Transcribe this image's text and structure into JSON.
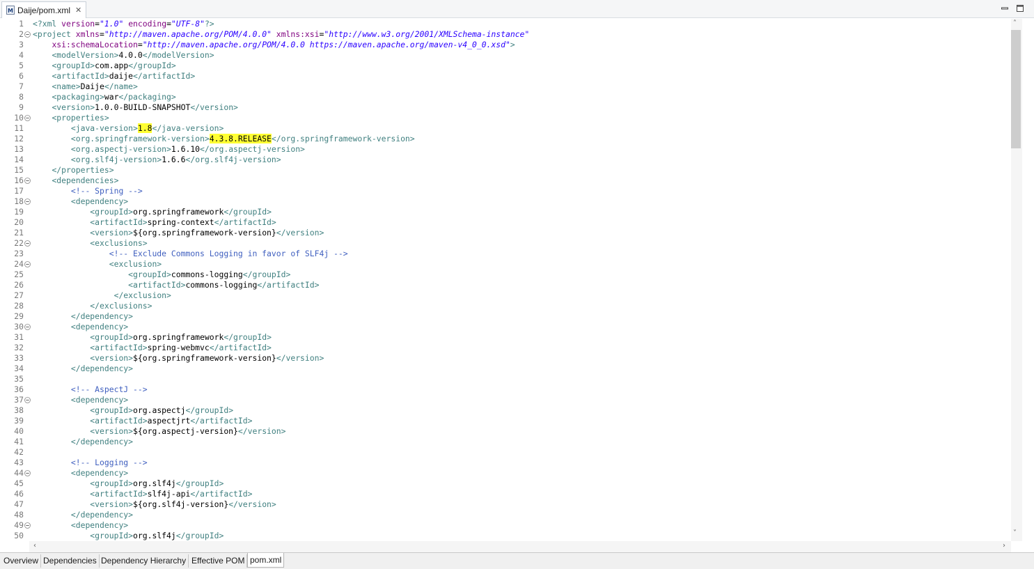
{
  "editor_tab": {
    "title": "Daije/pom.xml",
    "close": "✕",
    "icon": "maven-file-icon"
  },
  "window_controls": {
    "minimize": "minimize-icon",
    "maximize": "maximize-icon"
  },
  "colors": {
    "tag": "#3f7f7f",
    "attr": "#7f007f",
    "value": "#2a00ff",
    "comment": "#3f5fbf",
    "highlight": "#ffff33",
    "text": "#000000",
    "line_number": "#787878"
  },
  "code_lines": [
    {
      "n": "1",
      "fold": false,
      "indent": 0,
      "segs": [
        [
          "t",
          "<?xml "
        ],
        [
          "a",
          "version"
        ],
        [
          "x",
          "="
        ],
        [
          "s",
          "\"1.0\""
        ],
        [
          "x",
          " "
        ],
        [
          "a",
          "encoding"
        ],
        [
          "x",
          "="
        ],
        [
          "s",
          "\"UTF-8\""
        ],
        [
          "t",
          "?>"
        ]
      ]
    },
    {
      "n": "2",
      "fold": true,
      "indent": 0,
      "segs": [
        [
          "t",
          "<project "
        ],
        [
          "a",
          "xmlns"
        ],
        [
          "x",
          "="
        ],
        [
          "s",
          "\"http://maven.apache.org/POM/4.0.0\""
        ],
        [
          "x",
          " "
        ],
        [
          "a",
          "xmlns:xsi"
        ],
        [
          "x",
          "="
        ],
        [
          "s",
          "\"http://www.w3.org/2001/XMLSchema-instance\""
        ]
      ]
    },
    {
      "n": "3",
      "fold": false,
      "indent": 4,
      "segs": [
        [
          "a",
          "xsi:schemaLocation"
        ],
        [
          "x",
          "="
        ],
        [
          "s",
          "\"http://maven.apache.org/POM/4.0.0 https://maven.apache.org/maven-v4_0_0.xsd\""
        ],
        [
          "t",
          ">"
        ]
      ]
    },
    {
      "n": "4",
      "fold": false,
      "indent": 4,
      "segs": [
        [
          "t",
          "<modelVersion>"
        ],
        [
          "x",
          "4.0.0"
        ],
        [
          "t",
          "</modelVersion>"
        ]
      ]
    },
    {
      "n": "5",
      "fold": false,
      "indent": 4,
      "segs": [
        [
          "t",
          "<groupId>"
        ],
        [
          "x",
          "com.app"
        ],
        [
          "t",
          "</groupId>"
        ]
      ]
    },
    {
      "n": "6",
      "fold": false,
      "indent": 4,
      "segs": [
        [
          "t",
          "<artifactId>"
        ],
        [
          "x",
          "daije"
        ],
        [
          "t",
          "</artifactId>"
        ]
      ]
    },
    {
      "n": "7",
      "fold": false,
      "indent": 4,
      "segs": [
        [
          "t",
          "<name>"
        ],
        [
          "x",
          "Daije"
        ],
        [
          "t",
          "</name>"
        ]
      ]
    },
    {
      "n": "8",
      "fold": false,
      "indent": 4,
      "segs": [
        [
          "t",
          "<packaging>"
        ],
        [
          "x",
          "war"
        ],
        [
          "t",
          "</packaging>"
        ]
      ]
    },
    {
      "n": "9",
      "fold": false,
      "indent": 4,
      "segs": [
        [
          "t",
          "<version>"
        ],
        [
          "x",
          "1.0.0-BUILD-SNAPSHOT"
        ],
        [
          "t",
          "</version>"
        ]
      ]
    },
    {
      "n": "10",
      "fold": true,
      "indent": 4,
      "segs": [
        [
          "t",
          "<properties>"
        ]
      ]
    },
    {
      "n": "11",
      "fold": false,
      "indent": 8,
      "segs": [
        [
          "t",
          "<java-version>"
        ],
        [
          "h",
          "1.8"
        ],
        [
          "t",
          "</java-version>"
        ]
      ]
    },
    {
      "n": "12",
      "fold": false,
      "indent": 8,
      "segs": [
        [
          "t",
          "<org.springframework-version>"
        ],
        [
          "h",
          "4.3.8.RELEASE"
        ],
        [
          "t",
          "</org.springframework-version>"
        ]
      ]
    },
    {
      "n": "13",
      "fold": false,
      "indent": 8,
      "segs": [
        [
          "t",
          "<org.aspectj-version>"
        ],
        [
          "x",
          "1.6.10"
        ],
        [
          "t",
          "</org.aspectj-version>"
        ]
      ]
    },
    {
      "n": "14",
      "fold": false,
      "indent": 8,
      "segs": [
        [
          "t",
          "<org.slf4j-version>"
        ],
        [
          "x",
          "1.6.6"
        ],
        [
          "t",
          "</org.slf4j-version>"
        ]
      ]
    },
    {
      "n": "15",
      "fold": false,
      "indent": 4,
      "segs": [
        [
          "t",
          "</properties>"
        ]
      ]
    },
    {
      "n": "16",
      "fold": true,
      "indent": 4,
      "segs": [
        [
          "t",
          "<dependencies>"
        ]
      ]
    },
    {
      "n": "17",
      "fold": false,
      "indent": 8,
      "segs": [
        [
          "c",
          "<!-- Spring -->"
        ]
      ]
    },
    {
      "n": "18",
      "fold": true,
      "indent": 8,
      "segs": [
        [
          "t",
          "<dependency>"
        ]
      ]
    },
    {
      "n": "19",
      "fold": false,
      "indent": 12,
      "segs": [
        [
          "t",
          "<groupId>"
        ],
        [
          "x",
          "org.springframework"
        ],
        [
          "t",
          "</groupId>"
        ]
      ]
    },
    {
      "n": "20",
      "fold": false,
      "indent": 12,
      "segs": [
        [
          "t",
          "<artifactId>"
        ],
        [
          "x",
          "spring-context"
        ],
        [
          "t",
          "</artifactId>"
        ]
      ]
    },
    {
      "n": "21",
      "fold": false,
      "indent": 12,
      "segs": [
        [
          "t",
          "<version>"
        ],
        [
          "x",
          "${org.springframework-version}"
        ],
        [
          "t",
          "</version>"
        ]
      ]
    },
    {
      "n": "22",
      "fold": true,
      "indent": 12,
      "segs": [
        [
          "t",
          "<exclusions>"
        ]
      ]
    },
    {
      "n": "23",
      "fold": false,
      "indent": 16,
      "segs": [
        [
          "c",
          "<!-- Exclude Commons Logging in favor of SLF4j -->"
        ]
      ]
    },
    {
      "n": "24",
      "fold": true,
      "indent": 16,
      "segs": [
        [
          "t",
          "<exclusion>"
        ]
      ]
    },
    {
      "n": "25",
      "fold": false,
      "indent": 20,
      "segs": [
        [
          "t",
          "<groupId>"
        ],
        [
          "x",
          "commons-logging"
        ],
        [
          "t",
          "</groupId>"
        ]
      ]
    },
    {
      "n": "26",
      "fold": false,
      "indent": 20,
      "segs": [
        [
          "t",
          "<artifactId>"
        ],
        [
          "x",
          "commons-logging"
        ],
        [
          "t",
          "</artifactId>"
        ]
      ]
    },
    {
      "n": "27",
      "fold": false,
      "indent": 17,
      "segs": [
        [
          "t",
          "</exclusion>"
        ]
      ]
    },
    {
      "n": "28",
      "fold": false,
      "indent": 12,
      "segs": [
        [
          "t",
          "</exclusions>"
        ]
      ]
    },
    {
      "n": "29",
      "fold": false,
      "indent": 8,
      "segs": [
        [
          "t",
          "</dependency>"
        ]
      ]
    },
    {
      "n": "30",
      "fold": true,
      "indent": 8,
      "segs": [
        [
          "t",
          "<dependency>"
        ]
      ]
    },
    {
      "n": "31",
      "fold": false,
      "indent": 12,
      "segs": [
        [
          "t",
          "<groupId>"
        ],
        [
          "x",
          "org.springframework"
        ],
        [
          "t",
          "</groupId>"
        ]
      ]
    },
    {
      "n": "32",
      "fold": false,
      "indent": 12,
      "segs": [
        [
          "t",
          "<artifactId>"
        ],
        [
          "x",
          "spring-webmvc"
        ],
        [
          "t",
          "</artifactId>"
        ]
      ]
    },
    {
      "n": "33",
      "fold": false,
      "indent": 12,
      "segs": [
        [
          "t",
          "<version>"
        ],
        [
          "x",
          "${org.springframework-version}"
        ],
        [
          "t",
          "</version>"
        ]
      ]
    },
    {
      "n": "34",
      "fold": false,
      "indent": 8,
      "segs": [
        [
          "t",
          "</dependency>"
        ]
      ]
    },
    {
      "n": "35",
      "fold": false,
      "indent": 0,
      "segs": []
    },
    {
      "n": "36",
      "fold": false,
      "indent": 8,
      "segs": [
        [
          "c",
          "<!-- AspectJ -->"
        ]
      ]
    },
    {
      "n": "37",
      "fold": true,
      "indent": 8,
      "segs": [
        [
          "t",
          "<dependency>"
        ]
      ]
    },
    {
      "n": "38",
      "fold": false,
      "indent": 12,
      "segs": [
        [
          "t",
          "<groupId>"
        ],
        [
          "x",
          "org.aspectj"
        ],
        [
          "t",
          "</groupId>"
        ]
      ]
    },
    {
      "n": "39",
      "fold": false,
      "indent": 12,
      "segs": [
        [
          "t",
          "<artifactId>"
        ],
        [
          "x",
          "aspectjrt"
        ],
        [
          "t",
          "</artifactId>"
        ]
      ]
    },
    {
      "n": "40",
      "fold": false,
      "indent": 12,
      "segs": [
        [
          "t",
          "<version>"
        ],
        [
          "x",
          "${org.aspectj-version}"
        ],
        [
          "t",
          "</version>"
        ]
      ]
    },
    {
      "n": "41",
      "fold": false,
      "indent": 8,
      "segs": [
        [
          "t",
          "</dependency>"
        ]
      ]
    },
    {
      "n": "42",
      "fold": false,
      "indent": 0,
      "segs": []
    },
    {
      "n": "43",
      "fold": false,
      "indent": 8,
      "segs": [
        [
          "c",
          "<!-- Logging -->"
        ]
      ]
    },
    {
      "n": "44",
      "fold": true,
      "indent": 8,
      "segs": [
        [
          "t",
          "<dependency>"
        ]
      ]
    },
    {
      "n": "45",
      "fold": false,
      "indent": 12,
      "segs": [
        [
          "t",
          "<groupId>"
        ],
        [
          "x",
          "org.slf4j"
        ],
        [
          "t",
          "</groupId>"
        ]
      ]
    },
    {
      "n": "46",
      "fold": false,
      "indent": 12,
      "segs": [
        [
          "t",
          "<artifactId>"
        ],
        [
          "x",
          "slf4j-api"
        ],
        [
          "t",
          "</artifactId>"
        ]
      ]
    },
    {
      "n": "47",
      "fold": false,
      "indent": 12,
      "segs": [
        [
          "t",
          "<version>"
        ],
        [
          "x",
          "${org.slf4j-version}"
        ],
        [
          "t",
          "</version>"
        ]
      ]
    },
    {
      "n": "48",
      "fold": false,
      "indent": 8,
      "segs": [
        [
          "t",
          "</dependency>"
        ]
      ]
    },
    {
      "n": "49",
      "fold": true,
      "indent": 8,
      "segs": [
        [
          "t",
          "<dependency>"
        ]
      ]
    },
    {
      "n": "50",
      "fold": false,
      "indent": 12,
      "segs": [
        [
          "t",
          "<groupId>"
        ],
        [
          "x",
          "org.slf4j"
        ],
        [
          "t",
          "</groupId>"
        ]
      ]
    }
  ],
  "scrollbars": {
    "up": "˄",
    "down": "˅",
    "left": "‹",
    "right": "›"
  },
  "page_tabs": [
    {
      "label": "Overview",
      "active": false
    },
    {
      "label": "Dependencies",
      "active": false
    },
    {
      "label": "Dependency Hierarchy",
      "active": false
    },
    {
      "label": "Effective POM",
      "active": false
    },
    {
      "label": "pom.xml",
      "active": true
    }
  ]
}
